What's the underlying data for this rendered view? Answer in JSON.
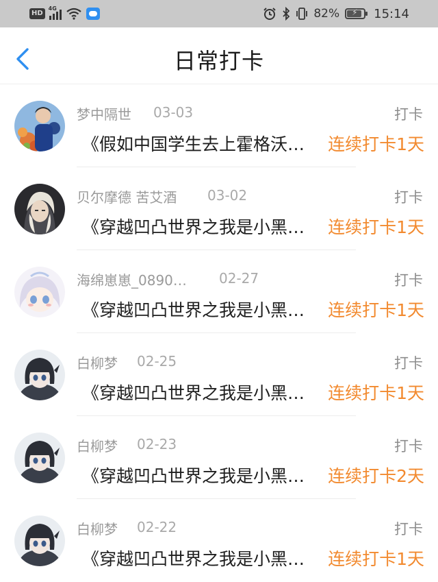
{
  "status_bar": {
    "hd_badge": "HD",
    "network": "4G",
    "battery_pct": "82%",
    "time": "15:14"
  },
  "header": {
    "title": "日常打卡"
  },
  "rows": [
    {
      "name": "梦中隔世",
      "date": "03-03",
      "action": "打卡",
      "book": "《假如中国学生去上霍格沃…",
      "streak": "连续打卡1天",
      "avatar": "flowers-portrait"
    },
    {
      "name": "贝尔摩德 苦艾酒",
      "date": "03-02",
      "action": "打卡",
      "book": "《穿越凹凸世界之我是小黑…",
      "streak": "连续打卡1天",
      "avatar": "dark-anime-portrait"
    },
    {
      "name": "海绵崽崽_0890…",
      "date": "02-27",
      "action": "打卡",
      "book": "《穿越凹凸世界之我是小黑…",
      "streak": "连续打卡1天",
      "avatar": "chibi-girl"
    },
    {
      "name": "白柳梦",
      "date": "02-25",
      "action": "打卡",
      "book": "《穿越凹凸世界之我是小黑…",
      "streak": "连续打卡1天",
      "avatar": "black-hair-girl"
    },
    {
      "name": "白柳梦",
      "date": "02-23",
      "action": "打卡",
      "book": "《穿越凹凸世界之我是小黑…",
      "streak": "连续打卡2天",
      "avatar": "black-hair-girl"
    },
    {
      "name": "白柳梦",
      "date": "02-22",
      "action": "打卡",
      "book": "《穿越凹凸世界之我是小黑…",
      "streak": "连续打卡1天",
      "avatar": "black-hair-girl"
    }
  ],
  "colors": {
    "accent_orange": "#f28a2f",
    "back_blue": "#2f8ff0",
    "muted_gray": "#9a9a9a"
  }
}
